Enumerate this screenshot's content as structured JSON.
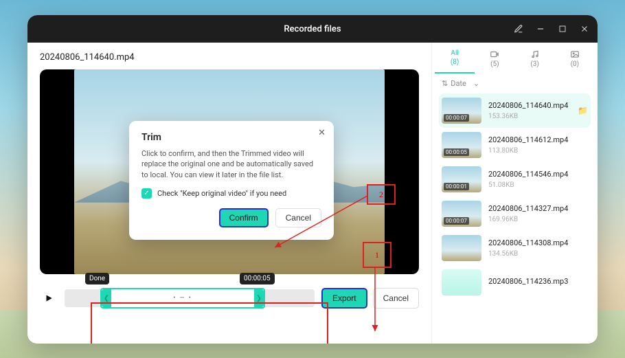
{
  "window": {
    "title": "Recorded files"
  },
  "current_file": "20240806_114640.mp4",
  "trim_dialog": {
    "title": "Trim",
    "text_pre": "Click to confirm, and then the ",
    "text_emph": "Trimmed",
    "text_post": " video will replace the original one and be automatically saved to local. You can view it later in the file list.",
    "check_label": "Check \"Keep original video\" if you need",
    "confirm": "Confirm",
    "cancel": "Cancel"
  },
  "timeline": {
    "done_label": "Done",
    "time_label": "00:00:05",
    "export": "Export",
    "cancel": "Cancel"
  },
  "annotations": {
    "label1": "1",
    "label2": "2"
  },
  "sidebar": {
    "tabs": [
      {
        "label": "All",
        "count": "(8)"
      },
      {
        "label": "",
        "count": "(5)"
      },
      {
        "label": "",
        "count": "(3)"
      },
      {
        "label": "",
        "count": "(0)"
      }
    ],
    "sort_label": "Date",
    "files": [
      {
        "name": "20240806_114640.mp4",
        "size": "153.36KB",
        "duration": "00:00:07",
        "active": true
      },
      {
        "name": "20240806_114612.mp4",
        "size": "113.80KB",
        "duration": "00:00:05"
      },
      {
        "name": "20240806_114546.mp4",
        "size": "51.08KB",
        "duration": "00:00:01"
      },
      {
        "name": "20240806_114327.mp4",
        "size": "169.96KB",
        "duration": "00:00:07"
      },
      {
        "name": "20240806_114308.mp4",
        "size": "134.56KB",
        "duration": ""
      },
      {
        "name": "20240806_114236.mp3",
        "size": "",
        "duration": "",
        "audio": true
      }
    ]
  }
}
